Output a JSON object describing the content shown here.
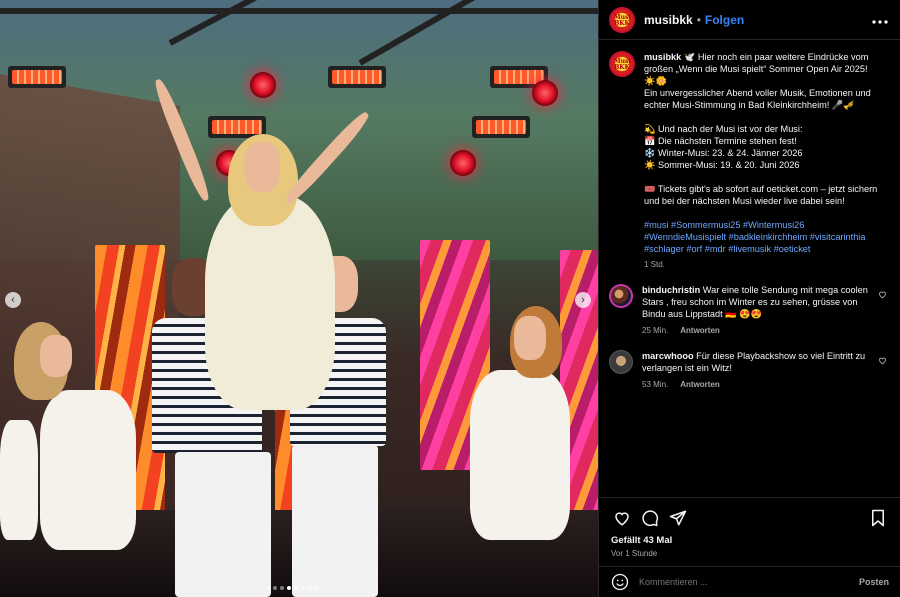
{
  "post": {
    "username": "musibkk",
    "separator": "•",
    "follow_label": "Folgen",
    "more_icon": "more-horizontal-icon",
    "avatar_text": "Musi BKK"
  },
  "caption": {
    "username": "musibkk",
    "line1": "🕊️ Hier noch ein paar weitere Eindrücke vom großen „Wenn die Musi spielt“ Sommer Open Air 2025! ☀️🌼",
    "line2": "Ein unvergesslicher Abend voller Musik, Emotionen und echter Musi-Stimmung in Bad Kleinkirchheim! 🎤🎺",
    "line3": "💫 Und nach der Musi ist vor der Musi:",
    "line4": "📅 Die nächsten Termine stehen fest!",
    "line5": "❄️ Winter-Musi: 23. & 24. Jänner 2026",
    "line6": "☀️ Sommer-Musi: 19. & 20. Juni 2026",
    "line7": "🎟️ Tickets gibt's ab sofort auf oeticket.com – jetzt sichern und bei der nächsten Musi wieder live dabei sein!",
    "hashtags": "#musi #Sommermusi25 #Wintermusi26 #WenndieMusispielt #badkleinkirchheim #visitcarinthia #schlager #orf #mdr #livemusik #oeticket",
    "time": "1 Std."
  },
  "comments": [
    {
      "username": "binduchristin",
      "text": "War eine tolle Sendung mit mega coolen Stars , freu schon im Winter es zu sehen, grüsse von Bindu aus Lippstadt 🇩🇪 😍😍",
      "time": "25 Min.",
      "reply": "Antworten"
    },
    {
      "username": "marcwhooo",
      "text": "Für diese Playbackshow so viel Eintritt zu verlangen ist ein Witz!",
      "time": "53 Min.",
      "reply": "Antworten"
    }
  ],
  "actions": {
    "likes": "Gefällt 43 Mal",
    "ago": "Vor 1 Stunde"
  },
  "comment_bar": {
    "placeholder": "Kommentieren ...",
    "post_label": "Posten"
  },
  "carousel": {
    "prev_icon": "chevron-left-icon",
    "next_icon": "chevron-right-icon",
    "prev_glyph": "‹",
    "next_glyph": "›"
  },
  "colors": {
    "link": "#3b82f6",
    "hashtag": "#6ea8fe",
    "muted": "#a8a8a8",
    "background": "#000000"
  }
}
